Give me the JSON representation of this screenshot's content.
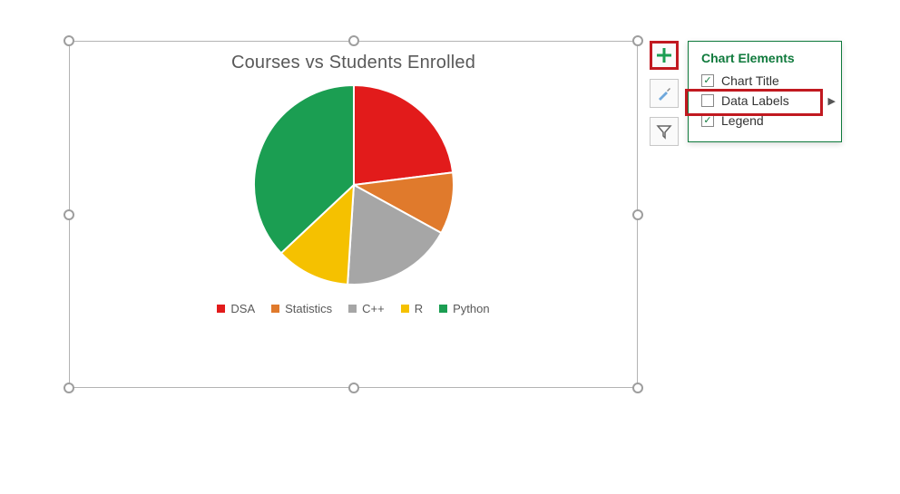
{
  "chart_data": {
    "type": "pie",
    "title": "Courses vs Students Enrolled",
    "series": [
      {
        "name": "DSA",
        "value": 23,
        "color": "#e21b1b"
      },
      {
        "name": "Statistics",
        "value": 10,
        "color": "#e07a2c"
      },
      {
        "name": "C++",
        "value": 18,
        "color": "#a6a6a6"
      },
      {
        "name": "R",
        "value": 12,
        "color": "#f5c100"
      },
      {
        "name": "Python",
        "value": 37,
        "color": "#1b9e52"
      }
    ]
  },
  "side_buttons": {
    "plus": {
      "name": "chart-elements-button",
      "icon": "plus-icon"
    },
    "brush": {
      "name": "chart-styles-button",
      "icon": "brush-icon"
    },
    "filter": {
      "name": "chart-filters-button",
      "icon": "filter-icon"
    }
  },
  "flyout": {
    "title": "Chart Elements",
    "items": [
      {
        "label": "Chart Title",
        "checked": true,
        "has_submenu": false,
        "highlighted": false
      },
      {
        "label": "Data Labels",
        "checked": false,
        "has_submenu": true,
        "highlighted": true
      },
      {
        "label": "Legend",
        "checked": true,
        "has_submenu": false,
        "highlighted": false
      }
    ]
  }
}
